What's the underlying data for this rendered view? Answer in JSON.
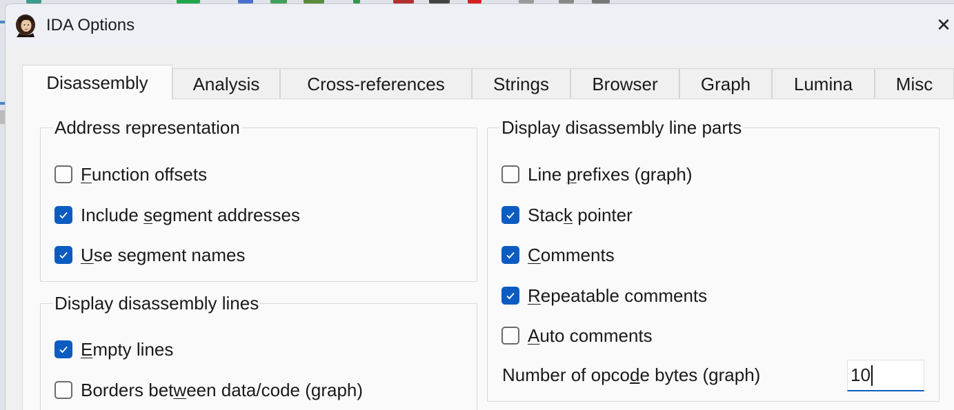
{
  "window": {
    "title": "IDA Options",
    "close_glyph": "✕"
  },
  "tabs": [
    {
      "label": "Disassembly",
      "active": true
    },
    {
      "label": "Analysis",
      "active": false
    },
    {
      "label": "Cross-references",
      "active": false
    },
    {
      "label": "Strings",
      "active": false
    },
    {
      "label": "Browser",
      "active": false
    },
    {
      "label": "Graph",
      "active": false
    },
    {
      "label": "Lumina",
      "active": false
    },
    {
      "label": "Misc",
      "active": false
    }
  ],
  "groups": {
    "address_representation": {
      "title": "Address representation",
      "items": [
        {
          "pre": "",
          "mn": "F",
          "post": "unction offsets",
          "checked": false
        },
        {
          "pre": "Include ",
          "mn": "s",
          "post": "egment addresses",
          "checked": true
        },
        {
          "pre": "",
          "mn": "U",
          "post": "se segment names",
          "checked": true
        }
      ]
    },
    "display_lines": {
      "title": "Display disassembly lines",
      "items": [
        {
          "pre": "",
          "mn": "E",
          "post": "mpty lines",
          "checked": true
        },
        {
          "pre": "Borders bet",
          "mn": "w",
          "post": "een data/code (graph)",
          "checked": false
        }
      ]
    },
    "display_line_parts": {
      "title": "Display disassembly line parts",
      "items": [
        {
          "pre": "Line ",
          "mn": "p",
          "post": "refixes (graph)",
          "checked": false
        },
        {
          "pre": "Stac",
          "mn": "k",
          "post": " pointer",
          "checked": true
        },
        {
          "pre": "",
          "mn": "C",
          "post": "omments",
          "checked": true
        },
        {
          "pre": "",
          "mn": "R",
          "post": "epeatable comments",
          "checked": true
        },
        {
          "pre": "",
          "mn": "A",
          "post": "uto comments",
          "checked": false
        }
      ],
      "opcode": {
        "pre": "Number of opco",
        "mn": "d",
        "post": "e bytes (graph)",
        "value": "10"
      }
    }
  },
  "colors": {
    "accent": "#0b5cc0",
    "panel": "#fafafa",
    "titlebar": "#eef0f6"
  },
  "icons": {
    "app": "portrait-icon",
    "check": "check-icon",
    "close": "close-icon"
  }
}
